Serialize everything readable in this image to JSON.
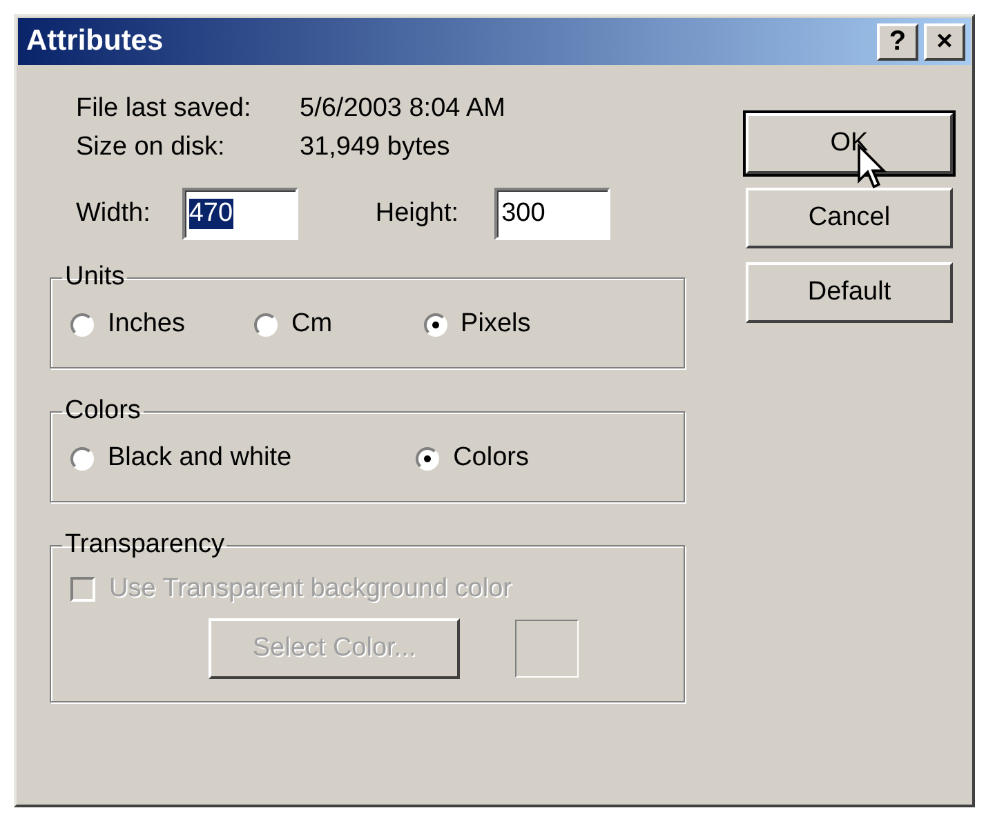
{
  "window": {
    "title": "Attributes",
    "title_buttons": [
      "?",
      "×"
    ]
  },
  "info": [
    {
      "label": "File last saved:",
      "value": "5/6/2003 8:04 AM"
    },
    {
      "label": "Size on disk:",
      "value": "31,949 bytes"
    }
  ],
  "size_fields": [
    {
      "label": "Width:",
      "value": "470",
      "selected": true
    },
    {
      "label": "Height:",
      "value": "300",
      "selected": false
    }
  ],
  "groups": [
    {
      "title": "Units",
      "disabled": false,
      "items": [
        {
          "kind": "radio",
          "label": "Inches",
          "selected": false
        },
        {
          "kind": "radio",
          "label": "Cm",
          "selected": false
        },
        {
          "kind": "radio",
          "label": "Pixels",
          "selected": true
        }
      ]
    },
    {
      "title": "Colors",
      "disabled": false,
      "items": [
        {
          "kind": "radio",
          "label": "Black and white",
          "selected": false
        },
        {
          "kind": "radio",
          "label": "Colors",
          "selected": true
        }
      ]
    },
    {
      "title": "Transparency",
      "disabled": false,
      "items": [
        {
          "kind": "checkbox",
          "label": "Use Transparent background color",
          "checked": false,
          "disabled": true
        },
        {
          "kind": "color_button",
          "label": "Select Color...",
          "disabled": true
        }
      ]
    }
  ],
  "buttons": [
    {
      "label": "OK",
      "default": true
    },
    {
      "label": "Cancel",
      "default": false
    },
    {
      "label": "Default",
      "default": false
    }
  ]
}
